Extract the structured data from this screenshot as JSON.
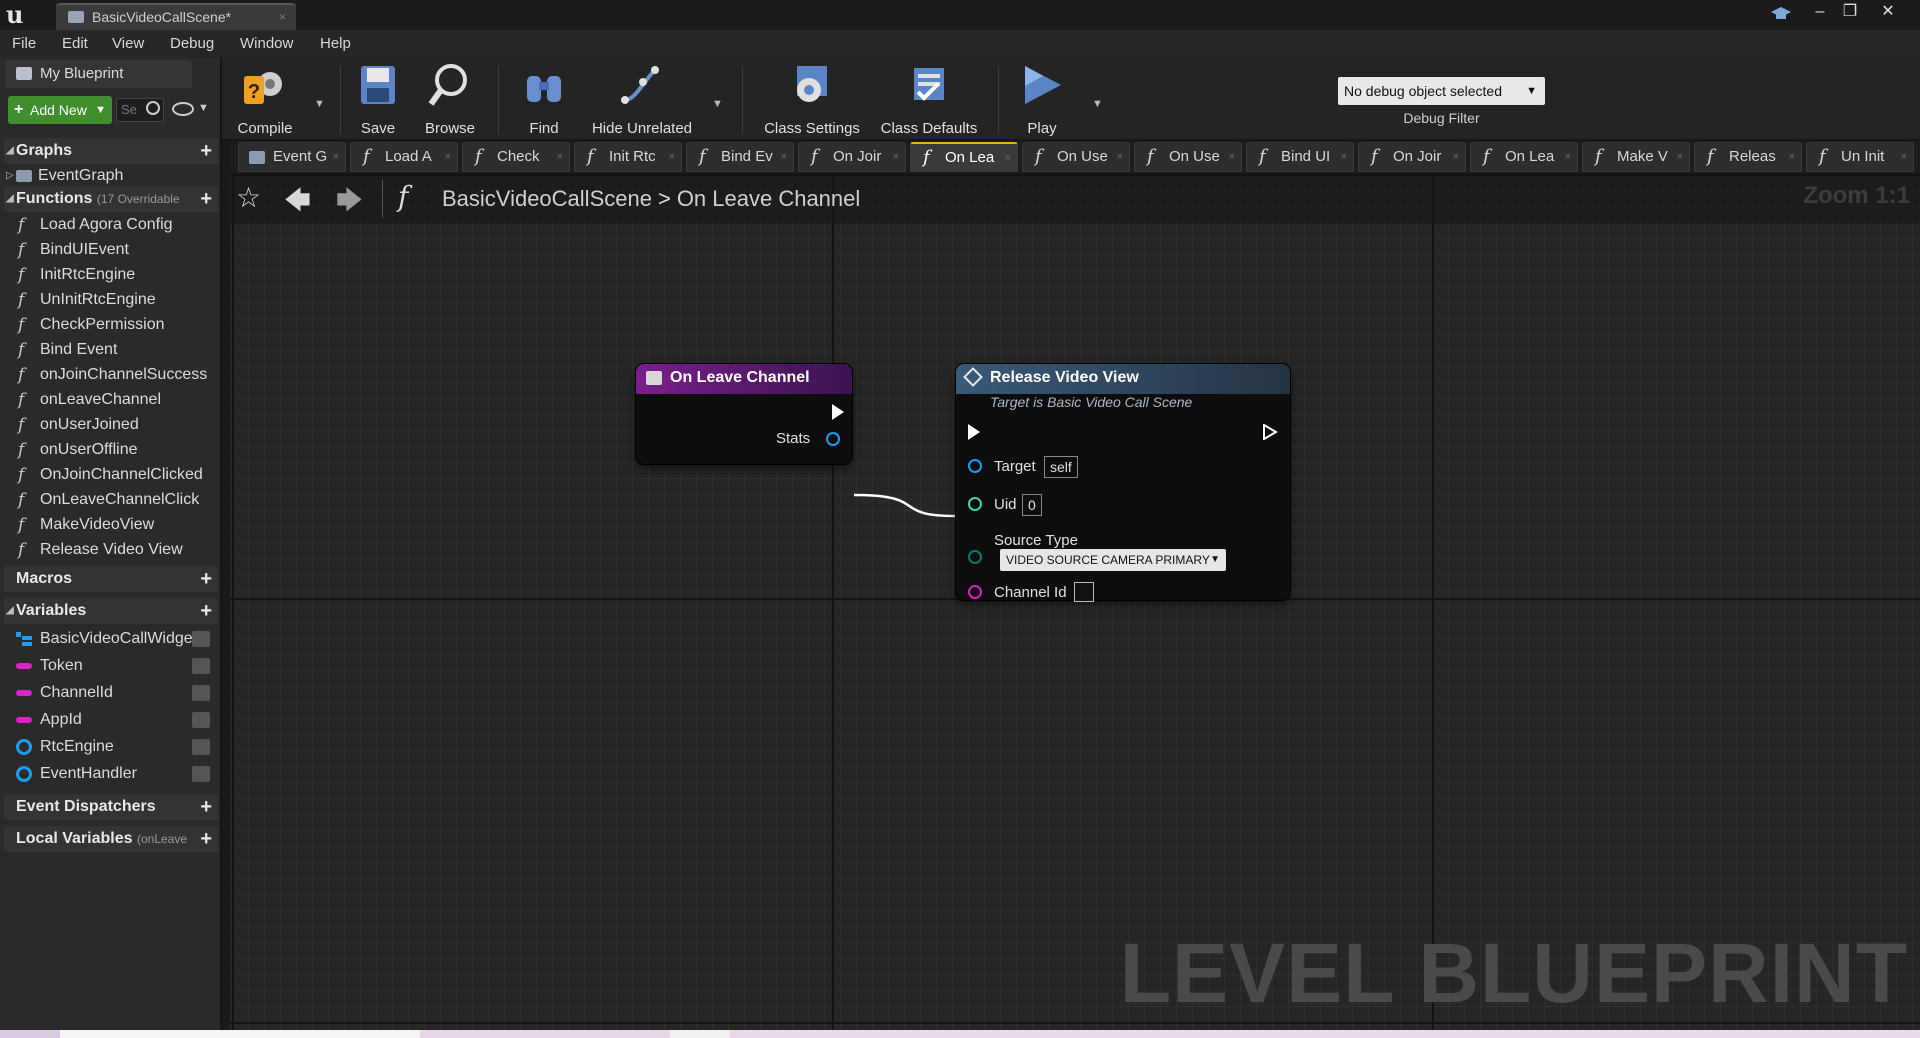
{
  "window": {
    "tab_title": "BasicVideoCallScene*",
    "tab_close": "×",
    "minimize": "–",
    "restore": "❐",
    "close": "✕"
  },
  "menu": [
    "File",
    "Edit",
    "View",
    "Debug",
    "Window",
    "Help"
  ],
  "my_blueprint": {
    "tab_label": "My Blueprint",
    "add_new_label": "Add New",
    "search_placeholder": "Se",
    "sections": {
      "graphs": "Graphs",
      "functions": "Functions",
      "functions_sub": "(17 Overridable",
      "macros": "Macros",
      "variables": "Variables",
      "event_dispatchers": "Event Dispatchers",
      "local_variables": "Local Variables",
      "local_variables_sub": "(onLeave"
    },
    "graphs": [
      "EventGraph"
    ],
    "functions": [
      "Load Agora Config",
      "BindUIEvent",
      "InitRtcEngine",
      "UnInitRtcEngine",
      "CheckPermission",
      "Bind Event",
      "onJoinChannelSuccess",
      "onLeaveChannel",
      "onUserJoined",
      "onUserOffline",
      "OnJoinChannelClicked",
      "OnLeaveChannelClick",
      "MakeVideoView",
      "Release Video View"
    ],
    "variables": [
      {
        "name": "BasicVideoCallWidget",
        "type": "struct"
      },
      {
        "name": "Token",
        "type": "string"
      },
      {
        "name": "ChannelId",
        "type": "string"
      },
      {
        "name": "AppId",
        "type": "string"
      },
      {
        "name": "RtcEngine",
        "type": "object"
      },
      {
        "name": "EventHandler",
        "type": "object"
      }
    ]
  },
  "toolbar": {
    "compile": "Compile",
    "save": "Save",
    "browse": "Browse",
    "find": "Find",
    "hide_unrelated": "Hide Unrelated",
    "class_settings": "Class Settings",
    "class_defaults": "Class Defaults",
    "play": "Play",
    "debug_object": "No debug object selected",
    "debug_filter": "Debug Filter"
  },
  "graph_tabs": [
    {
      "label": "Event G",
      "kind": "event"
    },
    {
      "label": "Load A",
      "kind": "function"
    },
    {
      "label": "Check",
      "kind": "function"
    },
    {
      "label": "Init Rtc",
      "kind": "function"
    },
    {
      "label": "Bind Ev",
      "kind": "function"
    },
    {
      "label": "On Joir",
      "kind": "function"
    },
    {
      "label": "On Lea",
      "kind": "function",
      "active": true
    },
    {
      "label": "On Use",
      "kind": "function"
    },
    {
      "label": "On Use",
      "kind": "function"
    },
    {
      "label": "Bind UI",
      "kind": "function"
    },
    {
      "label": "On Joir",
      "kind": "function"
    },
    {
      "label": "On Lea",
      "kind": "function"
    },
    {
      "label": "Make V",
      "kind": "function"
    },
    {
      "label": "Releas",
      "kind": "function"
    },
    {
      "label": "Un Init",
      "kind": "function"
    }
  ],
  "breadcrumb": {
    "blueprint": "BasicVideoCallScene",
    "graph": "On Leave Channel"
  },
  "zoom": "Zoom 1:1",
  "watermark": "LEVEL BLUEPRINT",
  "nodes": {
    "entry": {
      "title": "On Leave Channel",
      "pin_stats": "Stats",
      "header_color": "#7a1f8a"
    },
    "release": {
      "title": "Release Video View",
      "subtitle": "Target is Basic Video Call Scene",
      "pin_target": "Target",
      "target_value": "self",
      "pin_uid": "Uid",
      "uid_value": "0",
      "pin_source_type": "Source Type",
      "source_type_value": "VIDEO SOURCE CAMERA PRIMARY",
      "pin_channel_id": "Channel Id",
      "header_color": "#3a5a78"
    }
  },
  "colors": {
    "exec": "#ffffff",
    "object_pin": "#1e9cf0",
    "int_pin": "#3fd8a0",
    "byte_pin": "#0a7a6a",
    "string_pin": "#e020c8",
    "add_new": "#3f8f2f"
  }
}
